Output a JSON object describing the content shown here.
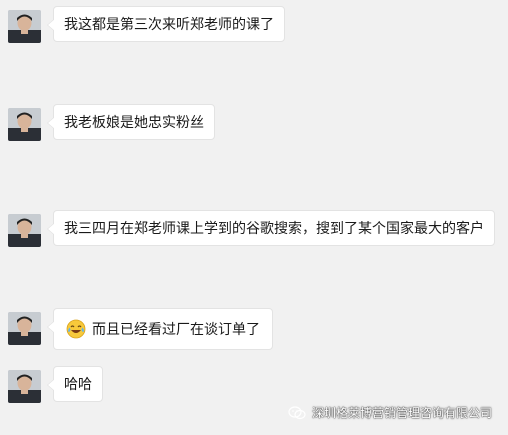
{
  "messages": [
    {
      "text": "我这都是第三次来听郑老师的课了"
    },
    {
      "text": "我老板娘是她忠实粉丝"
    },
    {
      "text": "我三四月在郑老师课上学到的谷歌搜索，搜到了某个国家最大的客户"
    },
    {
      "emoji": "laughing-crying-emoji",
      "text": "而且已经看过厂在谈订单了"
    },
    {
      "text": "哈哈"
    }
  ],
  "watermark": {
    "icon": "wechat-icon",
    "text": "深圳格莱博营销管理咨询有限公司"
  }
}
